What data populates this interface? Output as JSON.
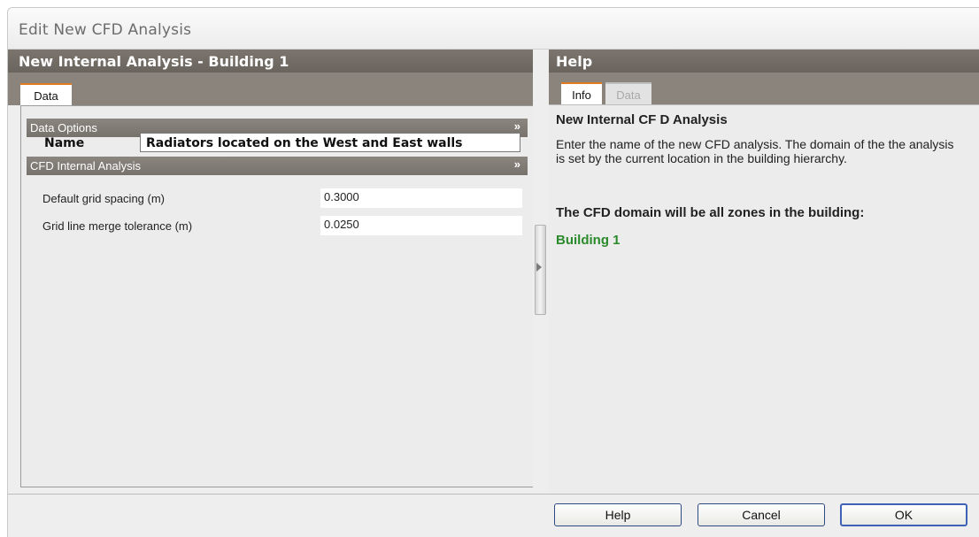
{
  "window": {
    "title": "Edit New CFD Analysis"
  },
  "left": {
    "header": "New Internal Analysis - Building 1",
    "tabs": [
      {
        "label": "Data",
        "active": true
      }
    ],
    "sections": [
      {
        "title": "Data Options",
        "rows": [
          {
            "label": "Name",
            "value": "Radiators located on the West and East walls"
          }
        ]
      },
      {
        "title": "CFD Internal Analysis",
        "rows": [
          {
            "label": "Default grid spacing (m)",
            "value": "0.3000"
          },
          {
            "label": "Grid line merge tolerance (m)",
            "value": "0.0250"
          }
        ]
      }
    ]
  },
  "right": {
    "header": "Help",
    "tabs": [
      {
        "label": "Info",
        "active": true
      },
      {
        "label": "Data",
        "active": false
      }
    ],
    "help": {
      "title": "New Internal CF D Analysis",
      "text": "Enter the name of the new CFD analysis. The domain of the the analysis is set by the current location in the building hierarchy.",
      "domain_text": "The CFD domain will be all zones in the building:",
      "building": "Building 1"
    }
  },
  "buttons": {
    "help": "Help",
    "cancel": "Cancel",
    "ok": "OK"
  },
  "colors": {
    "header_bg": "#6f6963",
    "tab_accent": "#e07b1f",
    "building_green": "#2b8a2b",
    "button_border": "#3e62b6"
  },
  "icons": {
    "section_collapse": "double-chevron-up-icon",
    "splitter": "splitter-arrow-right-icon"
  }
}
